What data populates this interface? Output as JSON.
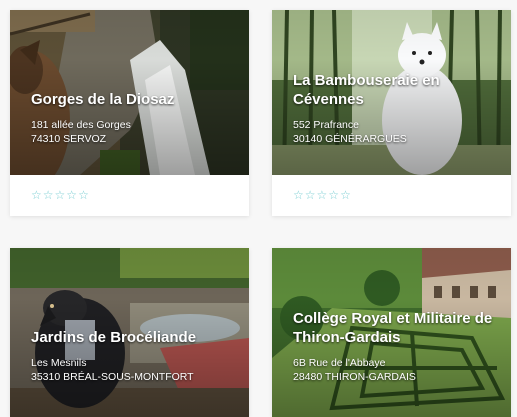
{
  "cards": [
    {
      "title": "Gorges de la Diosaz",
      "address_line1": "181 allée des Gorges",
      "address_line2": "74310 SERVOZ",
      "rating": 0,
      "stars": [
        "☆",
        "☆",
        "☆",
        "☆",
        "☆"
      ]
    },
    {
      "title": "La Bambouseraie en Cévennes",
      "address_line1": "552 Prafrance",
      "address_line2": "30140 GÉNÉRARGUES",
      "rating": 0,
      "stars": [
        "☆",
        "☆",
        "☆",
        "☆",
        "☆"
      ]
    },
    {
      "title": "Jardins de Brocéliande",
      "address_line1": "Les Mesnils",
      "address_line2": "35310 BRÉAL-SOUS-MONTFORT"
    },
    {
      "title": "Collège Royal et Militaire de Thiron-Gardais",
      "address_line1": "6B Rue de l'Abbaye",
      "address_line2": "28480 THIRON-GARDAIS"
    }
  ],
  "colors": {
    "star": "#7fd0d5",
    "card_bg": "#ffffff",
    "page_bg": "#f7f7f7"
  }
}
